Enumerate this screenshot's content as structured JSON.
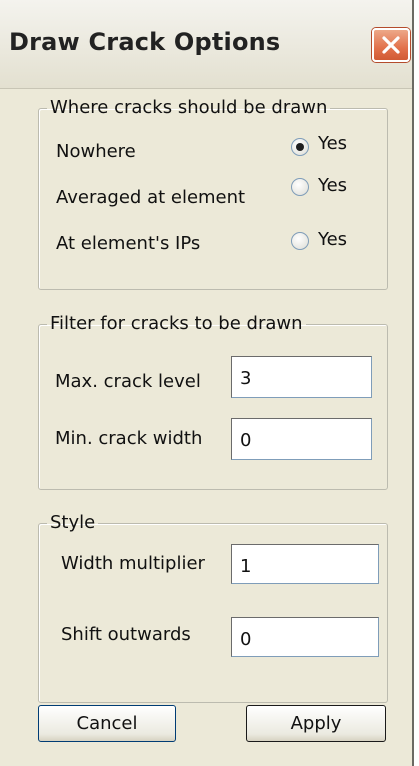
{
  "window": {
    "title": "Draw Crack Options"
  },
  "where_group": {
    "legend": "Where cracks should be drawn",
    "options": [
      {
        "label": "Nowhere",
        "radio_label": "Yes",
        "selected": true
      },
      {
        "label": "Averaged at element",
        "radio_label": "Yes",
        "selected": false
      },
      {
        "label": "At element's IPs",
        "radio_label": "Yes",
        "selected": false
      }
    ]
  },
  "filter_group": {
    "legend": "Filter for cracks to be drawn",
    "max_level_label": "Max. crack level",
    "max_level_value": "3",
    "min_width_label": "Min. crack width",
    "min_width_value": "0"
  },
  "style_group": {
    "legend": "Style",
    "width_multiplier_label": "Width multiplier",
    "width_multiplier_value": "1",
    "shift_outwards_label": "Shift outwards",
    "shift_outwards_value": "0"
  },
  "buttons": {
    "cancel": "Cancel",
    "apply": "Apply"
  }
}
